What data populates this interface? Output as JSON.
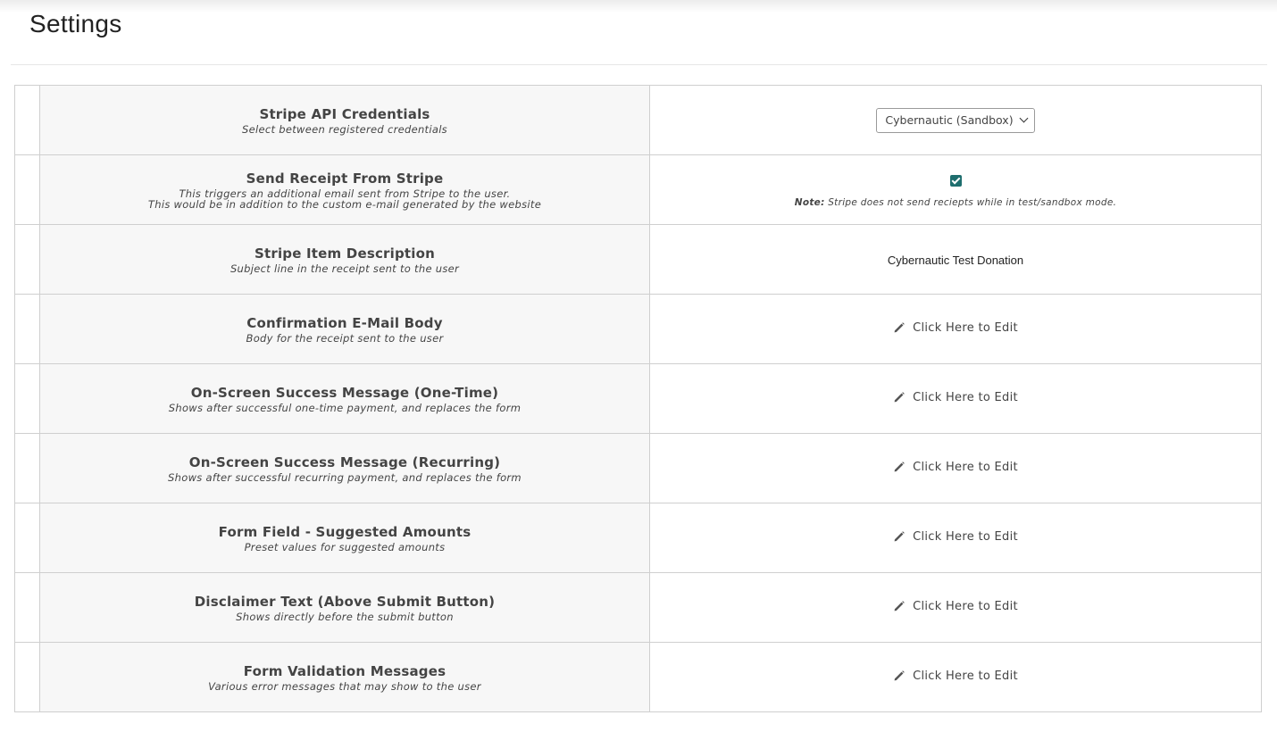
{
  "page": {
    "title": "Settings"
  },
  "icons": {
    "edit": "pencil-icon",
    "dropdown": "chevron-down-icon",
    "checkbox": "checkmark-icon"
  },
  "colors": {
    "checkbox_fill": "#1e6e6e",
    "label_column_bg": "#f7f7f7",
    "border": "#cfcfcf"
  },
  "settings": [
    {
      "name": "Stripe API Credentials",
      "desc": [
        "Select between registered credentials"
      ],
      "control": "select",
      "value": "Cybernautic (Sandbox)"
    },
    {
      "name": "Send Receipt From Stripe",
      "desc": [
        "This triggers an additional email sent from Stripe to the user.",
        "This would be in addition to the custom e-mail generated by the website"
      ],
      "control": "checkbox",
      "checked": true,
      "note_label": "Note:",
      "note_text": " Stripe does not send reciepts while in test/sandbox mode."
    },
    {
      "name": "Stripe Item Description",
      "desc": [
        "Subject line in the receipt sent to the user"
      ],
      "control": "text",
      "value": "Cybernautic Test Donation"
    },
    {
      "name": "Confirmation E-Mail Body",
      "desc": [
        "Body for the receipt sent to the user"
      ],
      "control": "edit",
      "value": "Click Here to Edit"
    },
    {
      "name": "On-Screen Success Message (One-Time)",
      "desc": [
        "Shows after successful one-time payment, and replaces the form"
      ],
      "control": "edit",
      "value": "Click Here to Edit"
    },
    {
      "name": "On-Screen Success Message (Recurring)",
      "desc": [
        "Shows after successful recurring payment, and replaces the form"
      ],
      "control": "edit",
      "value": "Click Here to Edit"
    },
    {
      "name": "Form Field - Suggested Amounts",
      "desc": [
        "Preset values for suggested amounts"
      ],
      "control": "edit",
      "value": "Click Here to Edit"
    },
    {
      "name": "Disclaimer Text (Above Submit Button)",
      "desc": [
        "Shows directly before the submit button"
      ],
      "control": "edit",
      "value": "Click Here to Edit"
    },
    {
      "name": "Form Validation Messages",
      "desc": [
        "Various error messages that may show to the user"
      ],
      "control": "edit",
      "value": "Click Here to Edit"
    }
  ]
}
